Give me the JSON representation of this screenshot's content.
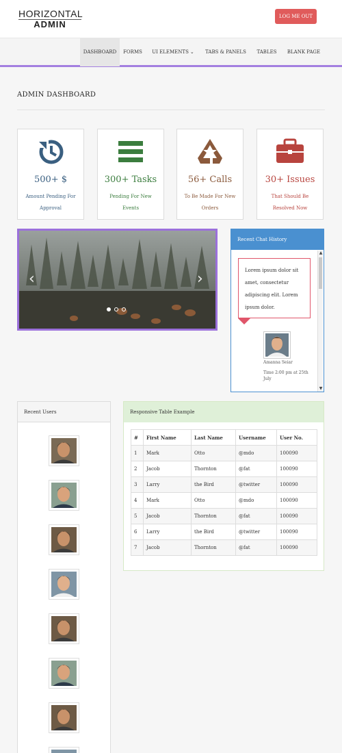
{
  "brand": {
    "line1": "HORIZONTAL",
    "line2": "ADMIN"
  },
  "header": {
    "logout_label": "LOG ME OUT",
    "logout_color": "#e05b5b"
  },
  "nav": {
    "items": [
      {
        "label": "DASHBOARD",
        "active": true
      },
      {
        "label": "FORMS"
      },
      {
        "label": "UI ELEMENTS",
        "has_dropdown": true
      },
      {
        "label": "TABS & PANELS"
      },
      {
        "label": "TABLES"
      },
      {
        "label": "BLANK PAGE"
      }
    ],
    "accent_color": "#a37fe0"
  },
  "page": {
    "title": "ADMIN DASHBOARD"
  },
  "stats": [
    {
      "value": "500+ $",
      "caption": "Amount Pending For Approval",
      "icon": "history-icon",
      "color": "#3a5f80"
    },
    {
      "value": "300+ Tasks",
      "caption": "Pending For New Events",
      "icon": "list-icon",
      "color": "#3b7d3e"
    },
    {
      "value": "56+ Calls",
      "caption": "To Be Made For New Orders",
      "icon": "recycle-icon",
      "color": "#8b5a3c"
    },
    {
      "value": "30+ Issues",
      "caption": "That Should Be Resolved Now",
      "icon": "briefcase-icon",
      "color": "#b8443e"
    }
  ],
  "carousel": {
    "slide_count": 3,
    "active_slide": 1
  },
  "chat": {
    "title": "Recent Chat History",
    "message": "Lorem ipsum dolor sit amet, consectetur adipiscing elit. Lorem ipsum dolor.",
    "author": "Amanna Seiar",
    "time": "Time 2:00 pm at 25th July"
  },
  "users": {
    "title": "Recent Users"
  },
  "table": {
    "title": "Responsive Table Example",
    "columns": [
      "#",
      "First Name",
      "Last Name",
      "Username",
      "User No."
    ],
    "rows": [
      [
        "1",
        "Mark",
        "Otto",
        "@mdo",
        "100090"
      ],
      [
        "2",
        "Jacob",
        "Thornton",
        "@fat",
        "100090"
      ],
      [
        "3",
        "Larry",
        "the Bird",
        "@twitter",
        "100090"
      ],
      [
        "4",
        "Mark",
        "Otto",
        "@mdo",
        "100090"
      ],
      [
        "5",
        "Jacob",
        "Thornton",
        "@fat",
        "100090"
      ],
      [
        "6",
        "Larry",
        "the Bird",
        "@twitter",
        "100090"
      ],
      [
        "7",
        "Jacob",
        "Thornton",
        "@fat",
        "100090"
      ]
    ]
  }
}
